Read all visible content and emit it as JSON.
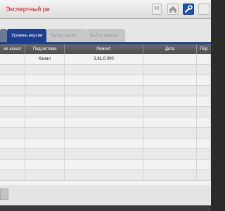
{
  "app": {
    "title": "Экспертный ре",
    "toolbar": {
      "k_label": "K!"
    }
  },
  "tabs": [
    {
      "label": ""
    },
    {
      "label": "Уровень версии"
    },
    {
      "label": "Выбор канал"
    },
    {
      "label": "Выбор версии"
    }
  ],
  "table": {
    "headers": [
      "ие канал",
      "Подсистема",
      "Ремонт",
      "Дата",
      "Пор"
    ],
    "rows": [
      [
        "",
        "Канал",
        "3.81.0.000",
        "",
        ""
      ],
      [
        "",
        "",
        "",
        "",
        ""
      ],
      [
        "",
        "",
        "",
        "",
        ""
      ],
      [
        "",
        "",
        "",
        "",
        ""
      ],
      [
        "",
        "",
        "",
        "",
        ""
      ],
      [
        "",
        "",
        "",
        "",
        ""
      ],
      [
        "",
        "",
        "",
        "",
        ""
      ],
      [
        "",
        "",
        "",
        "",
        ""
      ],
      [
        "",
        "",
        "",
        "",
        ""
      ],
      [
        "",
        "",
        "",
        "",
        ""
      ],
      [
        "",
        "",
        "",
        "",
        ""
      ],
      [
        "",
        "",
        "",
        "",
        ""
      ]
    ]
  }
}
